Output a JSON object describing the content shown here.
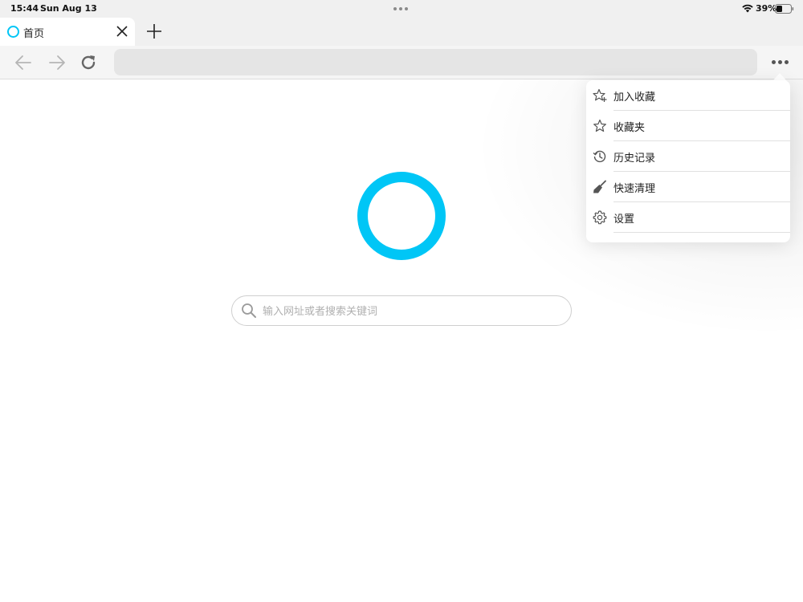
{
  "status_bar": {
    "time": "15:44",
    "date": "Sun Aug 13",
    "battery": "39%",
    "icons": [
      "wifi-icon",
      "battery-icon"
    ]
  },
  "tabs": [
    {
      "title": "首页",
      "favicon": "ring-logo-icon",
      "active": true
    }
  ],
  "toolbar": {
    "address": "",
    "icons": [
      "back-arrow-icon",
      "forward-arrow-icon",
      "reload-icon",
      "more-dots-icon"
    ]
  },
  "search": {
    "placeholder": "输入网址或者搜索关键词"
  },
  "menu": {
    "items": [
      {
        "label": "加入收藏",
        "icon": "star-add-icon"
      },
      {
        "label": "收藏夹",
        "icon": "star-icon"
      },
      {
        "label": "历史记录",
        "icon": "history-icon"
      },
      {
        "label": "快速清理",
        "icon": "broom-icon"
      },
      {
        "label": "设置",
        "icon": "gear-icon"
      }
    ]
  },
  "colors": {
    "accent": "#00c6f6",
    "chrome_bg": "#f0f0f0",
    "address_bg": "#e5e5e5"
  }
}
